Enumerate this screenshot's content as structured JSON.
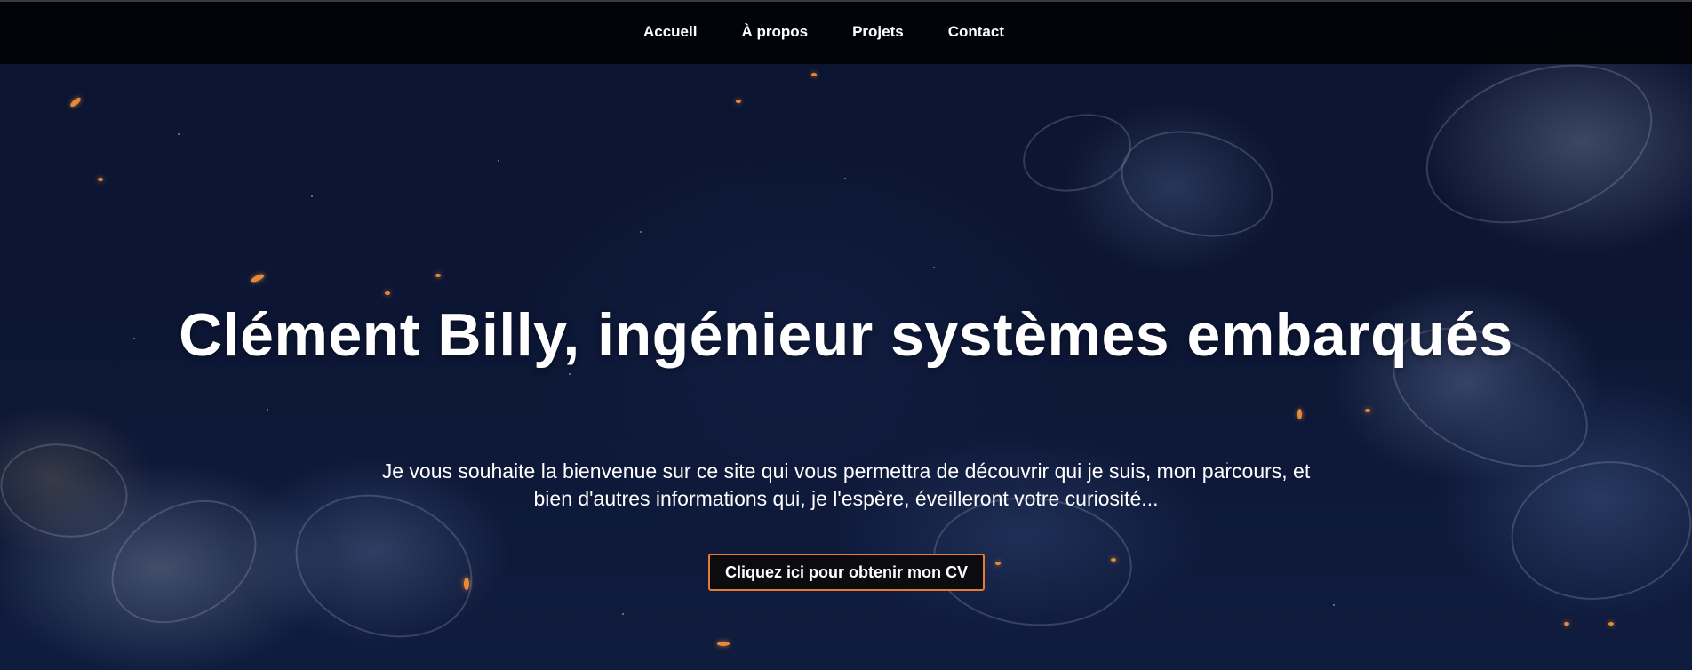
{
  "nav": {
    "items": [
      {
        "label": "Accueil"
      },
      {
        "label": "À propos"
      },
      {
        "label": "Projets"
      },
      {
        "label": "Contact"
      }
    ]
  },
  "hero": {
    "title": "Clément Billy, ingénieur systèmes embarqués",
    "intro": "Je vous souhaite la bienvenue sur ce site qui vous permettra de découvrir qui je suis, mon parcours, et bien d'autres informations qui, je l'espère, éveilleront votre curiosité...",
    "cv_button_label": "Cliquez ici pour obtenir mon CV"
  },
  "colors": {
    "navbar_bg": "#020306",
    "background": "#0c1634",
    "accent": "#e67a30",
    "text": "#ffffff"
  }
}
